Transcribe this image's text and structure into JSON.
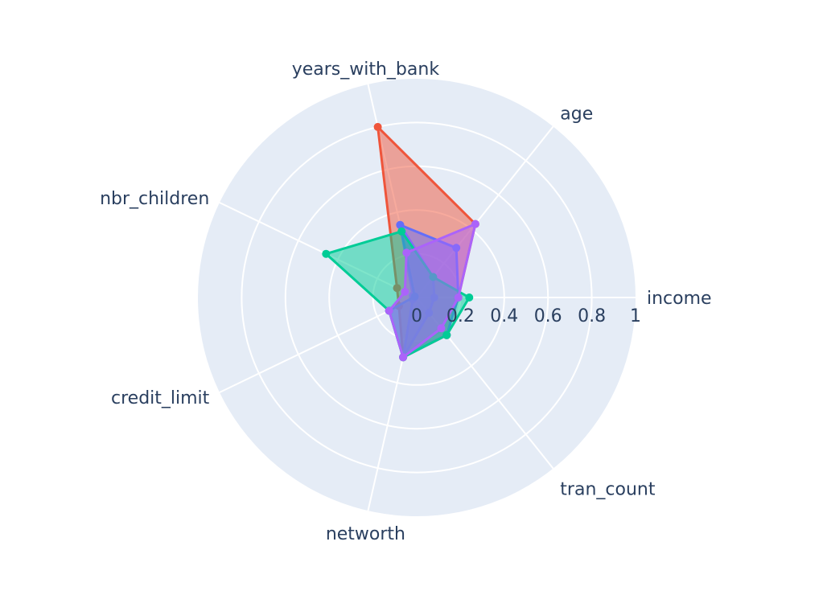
{
  "chart_data": {
    "type": "radar",
    "title": "",
    "axes": [
      "income",
      "age",
      "years_with_bank",
      "nbr_children",
      "credit_limit",
      "networth",
      "tran_count"
    ],
    "radial_range": [
      0,
      1
    ],
    "radial_ticks": [
      "0",
      "0.2",
      "0.4",
      "0.6",
      "0.8",
      "1"
    ],
    "radial_tick_values": [
      0,
      0.2,
      0.4,
      0.6,
      0.8,
      1
    ],
    "legend": "none",
    "series": [
      {
        "color": "#EF553B",
        "fill": "rgba(239,85,59,0.5)",
        "values": [
          0.19,
          0.43,
          0.8,
          0.1,
          0.09,
          0.28,
          0.22
        ]
      },
      {
        "color": "#AB63FA",
        "fill": "rgba(171,99,250,0.5)",
        "values": [
          0.08,
          0.12,
          0.34,
          0.02,
          0.02,
          0.28,
          0.09
        ]
      },
      {
        "color": "#636EFA",
        "fill": "rgba(99,110,250,0.5)",
        "values": [
          0.19,
          0.29,
          0.34,
          0.01,
          0.14,
          0.28,
          0.22
        ]
      },
      {
        "color": "#00CC96",
        "fill": "rgba(0,204,150,0.5)",
        "values": [
          0.24,
          0.12,
          0.31,
          0.46,
          0.14,
          0.28,
          0.22
        ]
      },
      {
        "color": "#AB63FA",
        "fill": "rgba(171,99,250,0.5)",
        "values": [
          0.19,
          0.43,
          0.21,
          0.06,
          0.14,
          0.28,
          0.18
        ]
      }
    ]
  }
}
